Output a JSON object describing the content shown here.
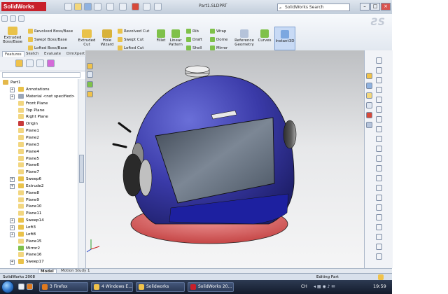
{
  "app": {
    "logo_text": "SolidWorks",
    "file_title": "Part1.SLDPRT",
    "search_placeholder": "SolidWorks Search",
    "brand_color": "#c8202a",
    "window_controls": [
      "minimize-icon",
      "maximize-icon",
      "close-icon"
    ]
  },
  "ribbon": {
    "extruded_boss": "Extruded Boss/Base",
    "revolved_boss": "Revolved Boss/Base",
    "swept_boss": "Swept Boss/Base",
    "lofted_boss": "Lofted Boss/Base",
    "extruded_cut": "Extruded Cut",
    "hole_wizard": "Hole Wizard",
    "revolved_cut": "Revolved Cut",
    "swept_cut": "Swept Cut",
    "lofted_cut": "Lofted Cut",
    "fillet": "Fillet",
    "linear_pattern": "Linear Pattern",
    "rib": "Rib",
    "draft": "Draft",
    "shell": "Shell",
    "wrap": "Wrap",
    "dome": "Dome",
    "mirror": "Mirror",
    "reference_geometry": "Reference Geometry",
    "curves": "Curves",
    "instant3d": "Instant3D"
  },
  "command_tabs": [
    {
      "label": "Features",
      "active": true
    },
    {
      "label": "Sketch",
      "active": false
    },
    {
      "label": "Evaluate",
      "active": false
    },
    {
      "label": "DimXpert",
      "active": false
    }
  ],
  "feature_tree": {
    "root": "Part1",
    "items": [
      {
        "label": "Annotations",
        "expandable": true,
        "icon": "annotations-icon"
      },
      {
        "label": "Material <not specified>",
        "expandable": true,
        "icon": "material-icon"
      },
      {
        "label": "Front Plane",
        "expandable": false,
        "icon": "plane-icon"
      },
      {
        "label": "Top Plane",
        "expandable": false,
        "icon": "plane-icon"
      },
      {
        "label": "Right Plane",
        "expandable": false,
        "icon": "plane-icon"
      },
      {
        "label": "Origin",
        "expandable": false,
        "icon": "origin-icon"
      },
      {
        "label": "Plane1",
        "expandable": false,
        "icon": "plane-icon"
      },
      {
        "label": "Plane2",
        "expandable": false,
        "icon": "plane-icon"
      },
      {
        "label": "Plane3",
        "expandable": false,
        "icon": "plane-icon"
      },
      {
        "label": "Plane4",
        "expandable": false,
        "icon": "plane-icon"
      },
      {
        "label": "Plane5",
        "expandable": false,
        "icon": "plane-icon"
      },
      {
        "label": "Plane6",
        "expandable": false,
        "icon": "plane-icon"
      },
      {
        "label": "Plane7",
        "expandable": false,
        "icon": "plane-icon"
      },
      {
        "label": "Sweep6",
        "expandable": true,
        "icon": "sweep-icon"
      },
      {
        "label": "Extrude2",
        "expandable": true,
        "icon": "extrude-icon"
      },
      {
        "label": "Plane8",
        "expandable": false,
        "icon": "plane-icon"
      },
      {
        "label": "Plane9",
        "expandable": false,
        "icon": "plane-icon"
      },
      {
        "label": "Plane10",
        "expandable": false,
        "icon": "plane-icon"
      },
      {
        "label": "Plane11",
        "expandable": false,
        "icon": "plane-icon"
      },
      {
        "label": "Sweep14",
        "expandable": true,
        "icon": "sweep-icon"
      },
      {
        "label": "Loft3",
        "expandable": true,
        "icon": "loft-icon"
      },
      {
        "label": "Loft8",
        "expandable": true,
        "icon": "loft-icon"
      },
      {
        "label": "Plane15",
        "expandable": false,
        "icon": "plane-icon"
      },
      {
        "label": "Mirror2",
        "expandable": false,
        "icon": "mirror-icon"
      },
      {
        "label": "Plane16",
        "expandable": false,
        "icon": "plane-icon"
      },
      {
        "label": "Sweep17",
        "expandable": true,
        "icon": "sweep-icon"
      }
    ]
  },
  "bottom_tabs": [
    {
      "label": "Model",
      "active": true
    },
    {
      "label": "Motion Study 1",
      "active": false
    }
  ],
  "status": {
    "left": "SolidWorks 2008",
    "right": "Editing Part"
  },
  "taskbar": {
    "items": [
      {
        "label": "3 Firefox",
        "color": "#e07a1f"
      },
      {
        "label": "4 Windows E...",
        "color": "#f0c24a"
      },
      {
        "label": "Solidworks",
        "color": "#f0c24a"
      },
      {
        "label": "SolidWorks 20...",
        "color": "#c8202a"
      }
    ],
    "clock": "19:59",
    "tray_text": "CH"
  }
}
